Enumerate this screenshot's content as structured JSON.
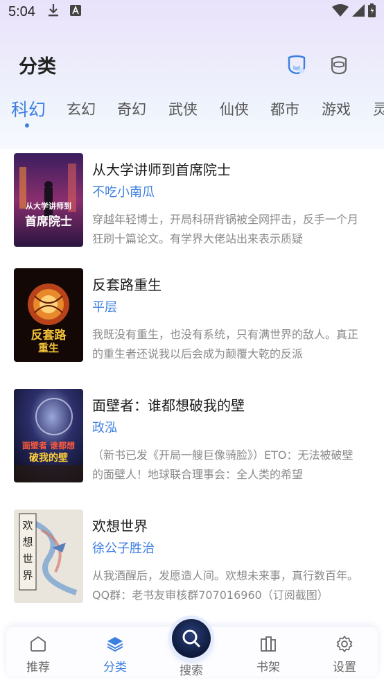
{
  "status_bar": {
    "time": "5:04",
    "icons": [
      "download-icon",
      "notification-a-icon",
      "wifi-icon",
      "signal-icon",
      "battery-icon"
    ]
  },
  "header": {
    "title": "分类",
    "icons": [
      "badge-icon",
      "mask-icon"
    ]
  },
  "tabs": [
    {
      "label": "科幻",
      "active": true
    },
    {
      "label": "玄幻",
      "active": false
    },
    {
      "label": "奇幻",
      "active": false
    },
    {
      "label": "武侠",
      "active": false
    },
    {
      "label": "仙侠",
      "active": false
    },
    {
      "label": "都市",
      "active": false
    },
    {
      "label": "游戏",
      "active": false
    },
    {
      "label": "灵",
      "active": false
    }
  ],
  "books": [
    {
      "title": "从大学讲师到首席院士",
      "author": "不吃小南瓜",
      "description": "穿越年轻博士，开局科研背锅被全网抨击，反手一个月狂刷十篇论文。有学界大佬站出来表示质疑",
      "cover_text": "从大学讲师到首席院士"
    },
    {
      "title": "反套路重生",
      "author": "平层",
      "description": "我既没有重生，也没有系统，只有满世界的敌人。真正的重生者还说我以后会成为颠覆大乾的反派",
      "cover_text": "反套路重生"
    },
    {
      "title": "面壁者：谁都想破我的壁",
      "author": "政泓",
      "description": "（新书已发《开局一艘巨像骑脸》）ETO：无法被破壁的面壁人！地球联合理事会：全人类的希望",
      "cover_text": "面壁者 谁都想破我的壁"
    },
    {
      "title": "欢想世界",
      "author": "徐公子胜治",
      "description": "从我酒醒后，发愿造人间。欢想未来事，真行数百年。QQ群：老书友审核群707016960（订阅截图）",
      "cover_text": "欢想世界"
    }
  ],
  "bottom_nav": {
    "items": [
      {
        "label": "推荐",
        "icon": "home-icon",
        "active": false
      },
      {
        "label": "分类",
        "icon": "layers-icon",
        "active": true
      },
      {
        "label": "搜索",
        "icon": "search-icon",
        "active": false
      },
      {
        "label": "书架",
        "icon": "bookshelf-icon",
        "active": false
      },
      {
        "label": "设置",
        "icon": "gear-icon",
        "active": false
      }
    ]
  },
  "colors": {
    "accent": "#3d7fe0",
    "title_text": "#1a1a1a",
    "desc_text": "#8a8a8a"
  }
}
